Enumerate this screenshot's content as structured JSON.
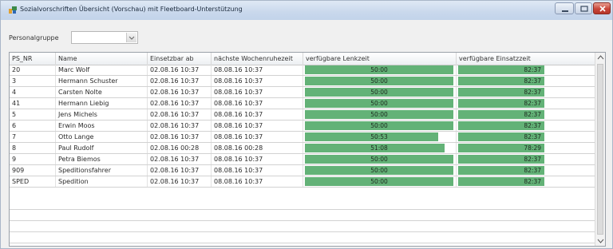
{
  "window": {
    "title": "Sozialvorschriften Übersicht (Vorschau) mit Fleetboard-Unterstützung"
  },
  "filter": {
    "label": "Personalgruppe",
    "value": ""
  },
  "table": {
    "columns": [
      "PS_NR",
      "Name",
      "Einsetzbar ab",
      "nächste Wochenruhezeit",
      "verfügbare Lenkzeit",
      "verfügbare Einsatzzeit"
    ],
    "rows": [
      {
        "ps_nr": "20",
        "name": "Marc Wolf",
        "einsetzbar": "02.08.16 10:37",
        "wochenruhe": "08.08.16 10:37",
        "lenkzeit": "50:00",
        "lenk_frac": 1.0,
        "einsatz": "82:37",
        "einsatz_frac": 1.0
      },
      {
        "ps_nr": "3",
        "name": "Hermann Schuster",
        "einsetzbar": "02.08.16 10:37",
        "wochenruhe": "08.08.16 10:37",
        "lenkzeit": "50:00",
        "lenk_frac": 1.0,
        "einsatz": "82:37",
        "einsatz_frac": 1.0
      },
      {
        "ps_nr": "4",
        "name": "Carsten Nolte",
        "einsetzbar": "02.08.16 10:37",
        "wochenruhe": "08.08.16 10:37",
        "lenkzeit": "50:00",
        "lenk_frac": 1.0,
        "einsatz": "82:37",
        "einsatz_frac": 1.0
      },
      {
        "ps_nr": "41",
        "name": "Hermann Liebig",
        "einsetzbar": "02.08.16 10:37",
        "wochenruhe": "08.08.16 10:37",
        "lenkzeit": "50:00",
        "lenk_frac": 1.0,
        "einsatz": "82:37",
        "einsatz_frac": 1.0
      },
      {
        "ps_nr": "5",
        "name": "Jens Michels",
        "einsetzbar": "02.08.16 10:37",
        "wochenruhe": "08.08.16 10:37",
        "lenkzeit": "50:00",
        "lenk_frac": 1.0,
        "einsatz": "82:37",
        "einsatz_frac": 1.0
      },
      {
        "ps_nr": "6",
        "name": "Erwin Moos",
        "einsetzbar": "02.08.16 10:37",
        "wochenruhe": "08.08.16 10:37",
        "lenkzeit": "50:00",
        "lenk_frac": 1.0,
        "einsatz": "82:37",
        "einsatz_frac": 1.0
      },
      {
        "ps_nr": "7",
        "name": "Otto Lange",
        "einsetzbar": "02.08.16 10:37",
        "wochenruhe": "08.08.16 10:37",
        "lenkzeit": "50:53",
        "lenk_frac": 0.9,
        "einsatz": "82:37",
        "einsatz_frac": 1.0
      },
      {
        "ps_nr": "8",
        "name": "Paul Rudolf",
        "einsetzbar": "02.08.16 00:28",
        "wochenruhe": "08.08.16 00:28",
        "lenkzeit": "51:08",
        "lenk_frac": 0.94,
        "einsatz": "78:29",
        "einsatz_frac": 1.0
      },
      {
        "ps_nr": "9",
        "name": "Petra Biemos",
        "einsetzbar": "02.08.16 10:37",
        "wochenruhe": "08.08.16 10:37",
        "lenkzeit": "50:00",
        "lenk_frac": 1.0,
        "einsatz": "82:37",
        "einsatz_frac": 1.0
      },
      {
        "ps_nr": "909",
        "name": "Speditionsfahrer",
        "einsetzbar": "02.08.16 10:37",
        "wochenruhe": "08.08.16 10:37",
        "lenkzeit": "50:00",
        "lenk_frac": 1.0,
        "einsatz": "82:37",
        "einsatz_frac": 1.0
      },
      {
        "ps_nr": "SPED",
        "name": "Spedition",
        "einsetzbar": "02.08.16 10:37",
        "wochenruhe": "08.08.16 10:37",
        "lenkzeit": "50:00",
        "lenk_frac": 1.0,
        "einsatz": "82:37",
        "einsatz_frac": 1.0
      }
    ]
  },
  "colors": {
    "bar_fill": "#63b277",
    "accent": "#c2d3ea"
  },
  "icons": {
    "app": "app-icon",
    "minimize": "minimize-icon",
    "maximize": "maximize-icon",
    "close": "close-icon",
    "dropdown": "chevron-down-icon"
  }
}
